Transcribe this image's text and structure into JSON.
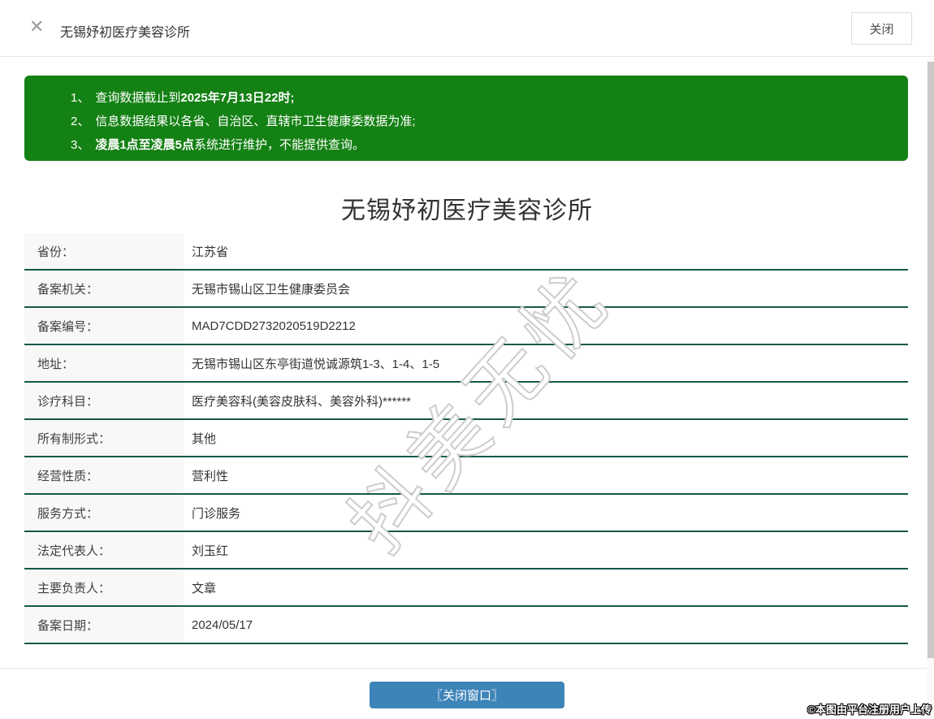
{
  "header": {
    "close_icon": "✕",
    "title": "无锡妤初医疗美容诊所",
    "close_button_label": "关闭"
  },
  "notice": {
    "items": [
      {
        "num": "1、",
        "segments": [
          {
            "text": "查询数据截止到",
            "bold": false
          },
          {
            "text": "2025年7月13日22时",
            "bold": true
          },
          {
            "text": ";",
            "bold": true
          }
        ]
      },
      {
        "num": "2、",
        "segments": [
          {
            "text": "信息数据结果以各省、自治区、直辖市卫生健康委数据为准;",
            "bold": false
          }
        ]
      },
      {
        "num": "3、",
        "segments": [
          {
            "text": "凌晨1点至凌晨5点",
            "bold": true
          },
          {
            "text": "系统进行维护，不能提供查询。",
            "bold": false
          }
        ]
      }
    ]
  },
  "main": {
    "title": "无锡妤初医疗美容诊所",
    "fields": [
      {
        "label": "省份：",
        "value": "江苏省"
      },
      {
        "label": "备案机关：",
        "value": "无锡市锡山区卫生健康委员会"
      },
      {
        "label": "备案编号：",
        "value": "MAD7CDD2732020519D2212"
      },
      {
        "label": "地址：",
        "value": "无锡市锡山区东亭街道悦诚源筑1-3、1-4、1-5"
      },
      {
        "label": "诊疗科目：",
        "value": "医疗美容科(美容皮肤科、美容外科)******"
      },
      {
        "label": "所有制形式：",
        "value": "其他"
      },
      {
        "label": "经营性质：",
        "value": "营利性"
      },
      {
        "label": "服务方式：",
        "value": "门诊服务"
      },
      {
        "label": "法定代表人：",
        "value": "刘玉红"
      },
      {
        "label": "主要负责人：",
        "value": "文章"
      },
      {
        "label": "备案日期：",
        "value": "2024/05/17"
      }
    ]
  },
  "footer": {
    "close_window_button_label": "〖关闭窗口〗"
  },
  "watermark_text": "抖美无忧",
  "copyright_text": "©本图由平台注册用户上传",
  "colors": {
    "notice_green": "#148114",
    "divider_teal": "#15594b",
    "button_blue": "#3d84b8",
    "label_bg": "#f8f8f8"
  }
}
